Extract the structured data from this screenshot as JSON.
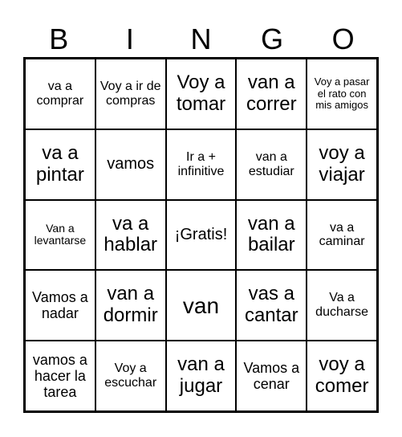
{
  "header": {
    "letters": [
      "B",
      "I",
      "N",
      "G",
      "O"
    ]
  },
  "cells": [
    [
      "va a comprar",
      "Voy a ir de compras",
      "Voy a tomar",
      "van a correr",
      "Voy a pasar el rato con mis amigos"
    ],
    [
      "va a pintar",
      "vamos",
      "Ir a + infinitive",
      "van a estudiar",
      "voy a viajar"
    ],
    [
      "Van a levantarse",
      "va a hablar",
      "¡Gratis!",
      "van a bailar",
      "va a caminar"
    ],
    [
      "Vamos a nadar",
      "van a dormir",
      "van",
      "vas a cantar",
      "Va a ducharse"
    ],
    [
      "vamos a hacer la tarea",
      "Voy a escuchar",
      "van a jugar",
      "Vamos a cenar",
      "voy a comer"
    ]
  ]
}
